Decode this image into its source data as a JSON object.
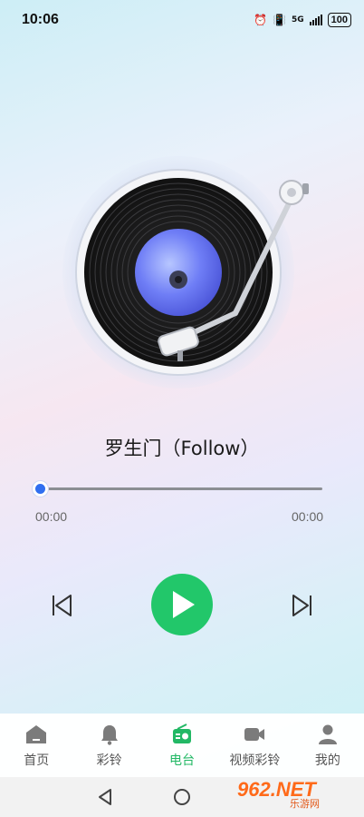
{
  "status_bar": {
    "time": "10:06",
    "network": "5G",
    "battery": "100"
  },
  "player": {
    "song_title": "罗生门（Follow）",
    "elapsed": "00:00",
    "duration": "00:00",
    "progress": 0,
    "play_color": "#22c76a",
    "accent_color": "#2f6ff0"
  },
  "tabs": [
    {
      "label": "首页",
      "icon": "home-icon",
      "active": false
    },
    {
      "label": "彩铃",
      "icon": "bell-icon",
      "active": false
    },
    {
      "label": "电台",
      "icon": "radio-icon",
      "active": true
    },
    {
      "label": "视频彩铃",
      "icon": "video-camera-icon",
      "active": false
    },
    {
      "label": "我的",
      "icon": "user-icon",
      "active": false
    }
  ],
  "watermark": {
    "brand": "962.NET",
    "sub": "乐游网"
  }
}
